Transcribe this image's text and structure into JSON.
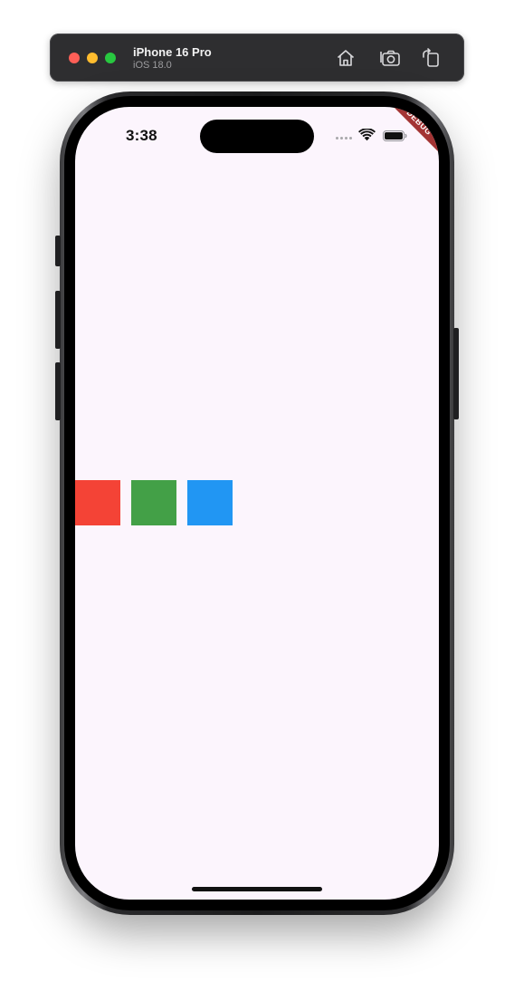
{
  "titlebar": {
    "device_name": "iPhone 16 Pro",
    "os_version": "iOS 18.0",
    "icons": [
      "home-icon",
      "screenshot-icon",
      "rotate-icon"
    ]
  },
  "status_bar": {
    "time": "3:38",
    "icons": [
      "cellular-signal-icon",
      "wifi-icon",
      "battery-icon"
    ]
  },
  "debug_banner": "DEBUG",
  "app": {
    "boxes": [
      {
        "name": "red-box",
        "color": "#f44336"
      },
      {
        "name": "green-box",
        "color": "#43a047"
      },
      {
        "name": "blue-box",
        "color": "#2196f3"
      }
    ]
  },
  "colors": {
    "screen_background": "#fcf5fd",
    "debug_banner": "#a33434",
    "titlebar": "#2e2e30"
  }
}
